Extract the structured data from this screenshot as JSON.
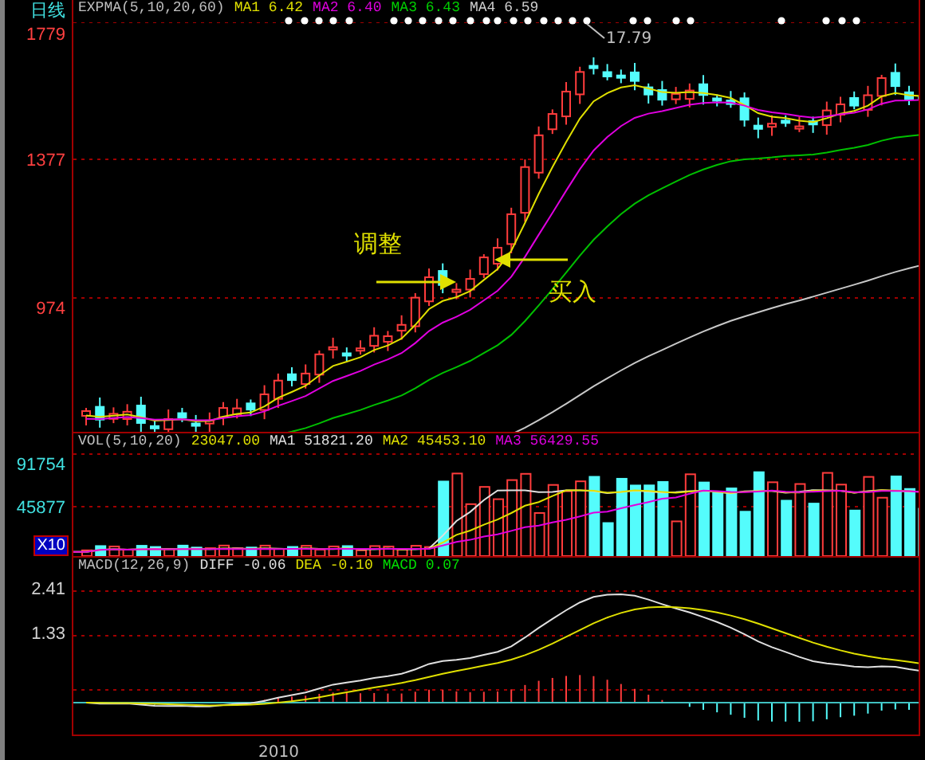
{
  "chart_label": "日线",
  "main_panel": {
    "legend": [
      {
        "text": "EXPMA(5,10,20,60)",
        "color": "#c0c0c0"
      },
      {
        "text": "MA1 6.42",
        "color": "#e0e000"
      },
      {
        "text": "MA2 6.40",
        "color": "#e000e0"
      },
      {
        "text": "MA3 6.43",
        "color": "#00d000"
      },
      {
        "text": "MA4 6.59",
        "color": "#d0d0d0"
      }
    ],
    "axis_labels": [
      "1779",
      "1377",
      "974"
    ],
    "annotations": {
      "peak_price": "17.79",
      "adjust_label": "调整",
      "buy_label": "买入"
    }
  },
  "volume_panel": {
    "legend": [
      {
        "text": "VOL(5,10,20)",
        "color": "#c0c0c0"
      },
      {
        "text": "23047.00",
        "color": "#e0e000"
      },
      {
        "text": "MA1 51821.20",
        "color": "#e0e0e0"
      },
      {
        "text": "MA2 45453.10",
        "color": "#e0e000"
      },
      {
        "text": "MA3 56429.55",
        "color": "#e000e0"
      }
    ],
    "axis_labels": [
      "91754",
      "45877"
    ],
    "scale_badge": "X10"
  },
  "macd_panel": {
    "legend": [
      {
        "text": "MACD(12,26,9)",
        "color": "#c0c0c0"
      },
      {
        "text": "DIFF -0.06",
        "color": "#e0e0e0"
      },
      {
        "text": "DEA -0.10",
        "color": "#e0e000"
      },
      {
        "text": "MACD 0.07",
        "color": "#00e000"
      }
    ],
    "axis_labels": [
      "2.41",
      "1.33"
    ]
  },
  "x_axis": {
    "labels": [
      "2010"
    ]
  }
}
